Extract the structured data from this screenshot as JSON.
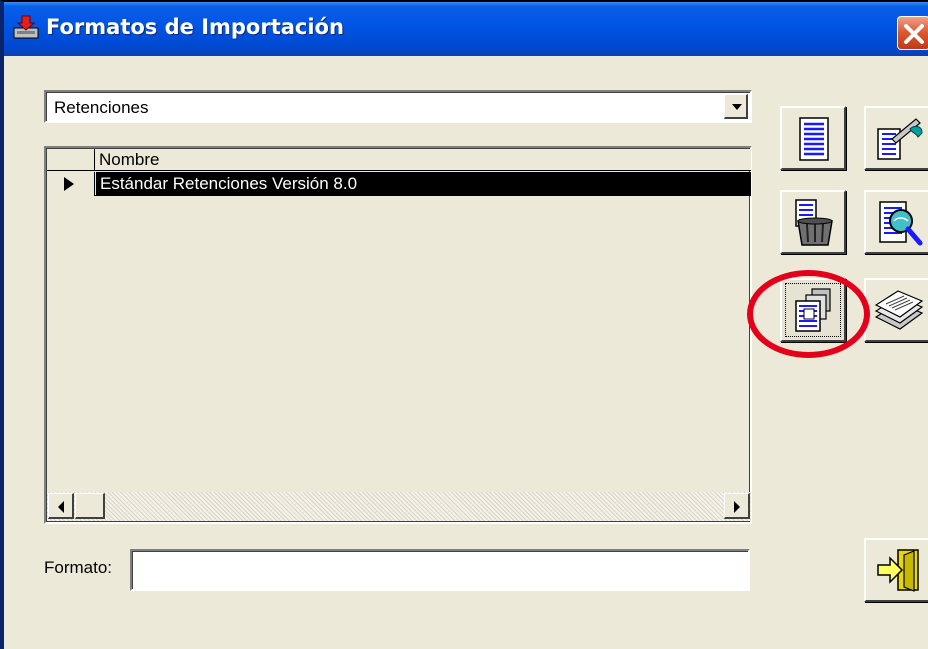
{
  "window": {
    "title": "Formatos de Importación",
    "close_icon": "close-icon",
    "app_icon": "import-icon"
  },
  "combo": {
    "selected": "Retenciones",
    "dropdown_icon": "chevron-down-icon"
  },
  "grid": {
    "columns": [
      "Nombre"
    ],
    "rows": [
      {
        "nombre": "Estándar Retenciones Versión 8.0",
        "selected": true
      }
    ]
  },
  "format": {
    "label": "Formato:",
    "value": ""
  },
  "toolbar": {
    "buttons": [
      {
        "id": "new",
        "icon": "new-document-icon"
      },
      {
        "id": "edit",
        "icon": "edit-document-icon"
      },
      {
        "id": "delete",
        "icon": "trash-document-icon"
      },
      {
        "id": "view",
        "icon": "magnify-document-icon"
      },
      {
        "id": "copy",
        "icon": "copy-format-icon",
        "focused": true
      },
      {
        "id": "stack",
        "icon": "document-stack-icon"
      },
      {
        "id": "exit",
        "icon": "exit-door-icon"
      }
    ]
  },
  "colors": {
    "title_bar": "#0054e3",
    "window_bg": "#ece9d8",
    "close_button": "#d9562f",
    "selection_bg": "#000000",
    "highlight_ring": "#e4001b"
  }
}
